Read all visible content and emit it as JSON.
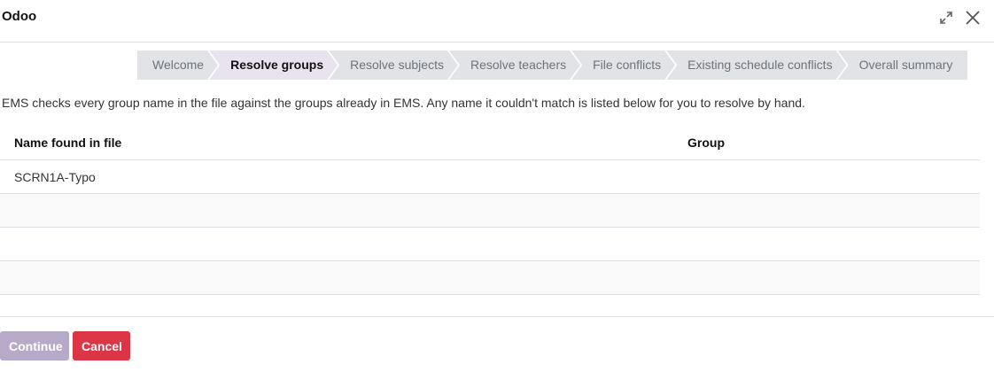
{
  "window": {
    "title": "Odoo"
  },
  "steps": [
    {
      "label": "Welcome",
      "active": false
    },
    {
      "label": "Resolve groups",
      "active": true
    },
    {
      "label": "Resolve subjects",
      "active": false
    },
    {
      "label": "Resolve teachers",
      "active": false
    },
    {
      "label": "File conflicts",
      "active": false
    },
    {
      "label": "Existing schedule conflicts",
      "active": false
    },
    {
      "label": "Overall summary",
      "active": false
    }
  ],
  "description": "EMS checks every group name in the file against the groups already in EMS. Any name it couldn't match is listed below for you to resolve by hand.",
  "table": {
    "columns": [
      "Name found in file",
      "Group"
    ],
    "rows": [
      {
        "name": "SCRN1A-Typo",
        "group": ""
      },
      {
        "name": "",
        "group": ""
      },
      {
        "name": "",
        "group": ""
      },
      {
        "name": "",
        "group": ""
      }
    ]
  },
  "footer": {
    "continue_label": "Continue",
    "cancel_label": "Cancel"
  },
  "colors": {
    "accent": "#b7aac9",
    "danger": "#dc3545",
    "step_bg": "#e2e3e7",
    "step_active_bg": "#e9e3f0"
  }
}
